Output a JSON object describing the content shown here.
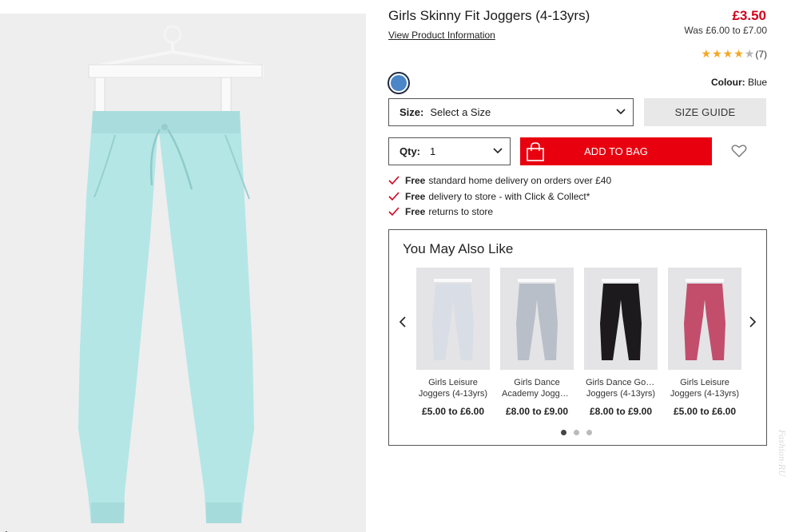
{
  "product": {
    "title": "Girls Skinny Fit Joggers (4-13yrs)",
    "view_info_link": "View Product Information",
    "price": "£3.50",
    "was_price": "Was £6.00 to £7.00",
    "rating_stars": 4,
    "rating_max": 5,
    "review_count": "(7)",
    "image_color": "#b4e6e6",
    "zoom_icon": "plus-icon"
  },
  "colour": {
    "label": "Colour:",
    "value": "Blue",
    "swatch_hex": "#4a86c8"
  },
  "size": {
    "label": "Size:",
    "value": "Select a Size",
    "guide_label": "SIZE GUIDE"
  },
  "quantity": {
    "label": "Qty:",
    "value": "1"
  },
  "bag": {
    "label": "ADD TO BAG",
    "accent": "#e8000f"
  },
  "delivery": [
    {
      "bold": "Free",
      "text": "standard home delivery on orders over £40"
    },
    {
      "bold": "Free",
      "text": "delivery to store - with Click & Collect*"
    },
    {
      "bold": "Free",
      "text": "returns to store"
    }
  ],
  "recommendations": {
    "title": "You May Also Like",
    "items": [
      {
        "name_line1": "Girls Leisure",
        "name_line2": "Joggers (4-13yrs)",
        "price": "£5.00 to £6.00",
        "color": "#d9dde6"
      },
      {
        "name_line1": "Girls Dance",
        "name_line2": "Academy Jogger...",
        "price": "£8.00 to £9.00",
        "color": "#b9bfc9"
      },
      {
        "name_line1": "Girls Dance Goals",
        "name_line2": "Joggers (4-13yrs)",
        "price": "£8.00 to £9.00",
        "color": "#1c1a1c"
      },
      {
        "name_line1": "Girls Leisure",
        "name_line2": "Joggers (4-13yrs)",
        "price": "£5.00 to £6.00",
        "color": "#c24e6c"
      }
    ],
    "active_page": 1,
    "page_count": 3
  },
  "watermark": "Fashion-RU"
}
